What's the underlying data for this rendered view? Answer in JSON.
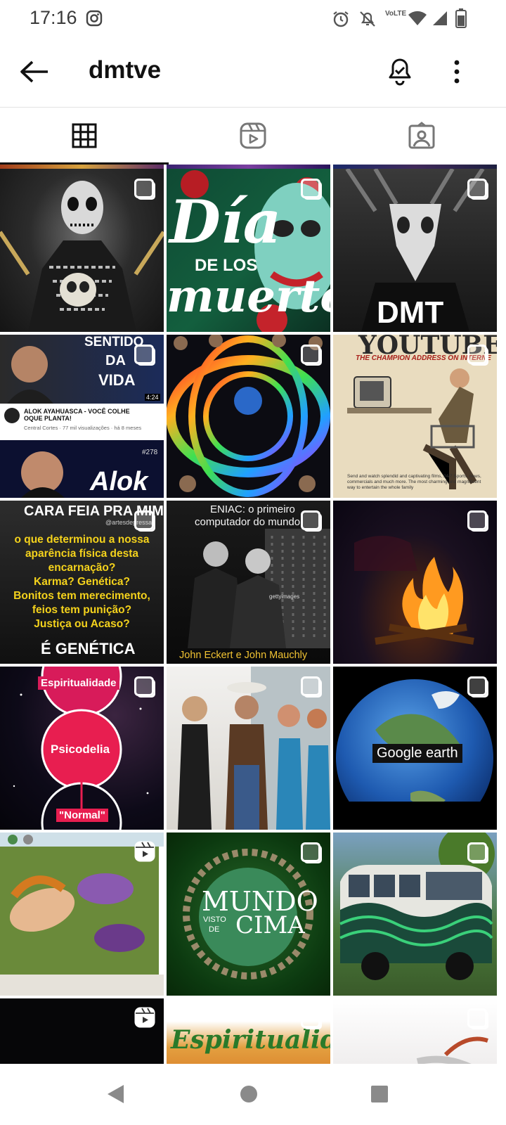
{
  "status_bar": {
    "time": "17:16",
    "network": "VoLTE"
  },
  "header": {
    "username": "dmtve"
  },
  "tabs": [
    {
      "name": "posts-grid-tab"
    },
    {
      "name": "reels-tab"
    },
    {
      "name": "tagged-tab"
    }
  ],
  "posts": {
    "p1": {},
    "p2": {
      "line1": "Día",
      "line2": "DE LOS",
      "line3": "muertos"
    },
    "p3": {
      "label": "DMT"
    },
    "p4": {
      "top": "SENTIDO",
      "da": "DA",
      "vida": "VIDA",
      "duration": "4:24",
      "video_title": "ALOK AYAHUASCA - VOCÊ COLHE OQUE PLANTA!",
      "video_meta": "Central Cortes · 77 mil visualizações · há 8 meses",
      "name": "Alok",
      "badge": "#278"
    },
    "p5": {},
    "p6": {
      "title": "YOUTUBE",
      "subtitle": "THE CHAMPION ADDRESS ON INTERNE",
      "caption": "Send and watch splendid and captivating films, 24/7 Sports, news, commercials and much more. The most charming and magnificent way to entertain the whole family"
    },
    "p7": {
      "title": "CARA FEIA PRA MIM",
      "handle": "@artesdepressao",
      "body": [
        "o que determinou a nossa",
        "aparência física desta",
        "encarnação?",
        "Karma? Genética?",
        "Bonitos tem merecimento,",
        "feios tem punição?",
        "Justiça ou Acaso?"
      ],
      "answer": "É GENÉTICA"
    },
    "p8": {
      "title1": "ENIAC: o primeiro",
      "title2": "computador do mundo",
      "watermark": "gettyimages",
      "caption": "John Eckert e John Mauchly"
    },
    "p9": {},
    "p10": {
      "top": "Espiritualidade",
      "mid": "Psicodelia",
      "bottom": "\"Normal\""
    },
    "p11": {},
    "p12": {
      "label": "Google earth"
    },
    "p13": {},
    "p14": {
      "line1": "MUNDO",
      "visto": "VISTO",
      "de": "DE",
      "cima": "CIMA"
    },
    "p15": {},
    "p16": {},
    "p17": {
      "text": "Espiritualidade"
    },
    "p18": {}
  }
}
